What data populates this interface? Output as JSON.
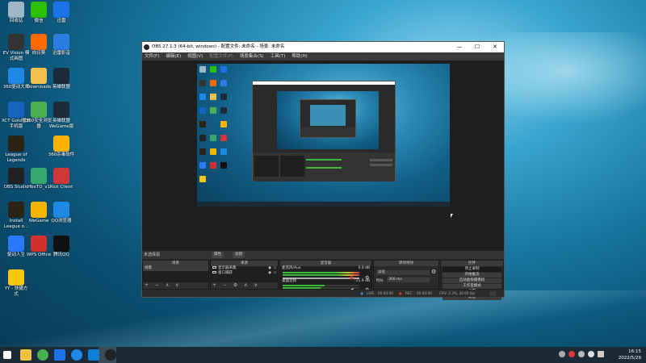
{
  "desktop": {
    "icons": [
      {
        "label": "回收站",
        "color": "#9fb8c8"
      },
      {
        "label": "微信",
        "color": "#2dc100"
      },
      {
        "label": "迅雷",
        "color": "#1a73e8"
      },
      {
        "label": "EV Vision 模\n式画图",
        "color": "#333333"
      },
      {
        "label": "向日葵",
        "color": "#ff6a00"
      },
      {
        "label": "迅雷影音",
        "color": "#2a7de1"
      },
      {
        "label": "360驱动大师",
        "color": "#1e88e5"
      },
      {
        "label": "Downloads",
        "color": "#f2c14e"
      },
      {
        "label": "英雄联盟",
        "color": "#1b2b3a"
      },
      {
        "label": "XCT Gold播放\n手机版",
        "color": "#1565c0"
      },
      {
        "label": "360安全浏览\n器",
        "color": "#4caf50"
      },
      {
        "label": "英雄联盟\nWeGame版",
        "color": "#1b2b3a"
      },
      {
        "label": "League of\nLegends",
        "color": "#2b2416"
      },
      {
        "label": "",
        "color": "#00000000"
      },
      {
        "label": "360杀毒软件",
        "color": "#ffb300"
      },
      {
        "label": "OBS Studio",
        "color": "#222222"
      },
      {
        "label": "HbxTO_v1",
        "color": "#37a86b"
      },
      {
        "label": "Riot Client",
        "color": "#d13639"
      },
      {
        "label": "Install\nLeague o...",
        "color": "#2b2416"
      },
      {
        "label": "WeGame",
        "color": "#f7b400"
      },
      {
        "label": "QQ浏览器",
        "color": "#1e88e5"
      },
      {
        "label": "驱动人生",
        "color": "#2979ff"
      },
      {
        "label": "WPS Office",
        "color": "#d32f2f"
      },
      {
        "label": "腾讯QQ",
        "color": "#111111"
      },
      {
        "label": "YY - 快捷方\n式",
        "color": "#f9c80e"
      }
    ]
  },
  "obs": {
    "title": "OBS 27.1.3 (64-bit, windows) - 配置文件: 未命名 - 场景: 未命名",
    "window_buttons": {
      "minimize": "—",
      "maximize": "☐",
      "close": "✕"
    },
    "menu": [
      "文件(F)",
      "编辑(E)",
      "视图(V)",
      "配置文件(P)",
      "场景集合(S)",
      "工具(T)",
      "帮助(H)"
    ],
    "source_bar": {
      "label": "未选择源",
      "properties": "属性",
      "filters": "滤镜"
    },
    "docks": {
      "scenes": {
        "title": "场景",
        "items": [
          "场景"
        ]
      },
      "sources": {
        "title": "来源",
        "items": [
          {
            "name": "显示器采集"
          },
          {
            "name": "窗口捕获"
          }
        ]
      },
      "mixer": {
        "title": "混音器",
        "channels": [
          {
            "name": "麦克风/Aux",
            "db": "0.0 dB"
          },
          {
            "name": "桌面音频",
            "db": "-11.9 dB"
          }
        ]
      },
      "transitions": {
        "title": "转场特效",
        "type": "淡化",
        "duration_label": "时长",
        "duration": "300 ms"
      },
      "controls": {
        "title": "控件",
        "buttons": [
          "停止录制",
          "开始推流",
          "启动虚拟摄像机",
          "工作室模式",
          "设置",
          "退出"
        ]
      }
    },
    "status": {
      "live_label": "LIVE:",
      "live_time": "00:00:00",
      "rec_label": "REC:",
      "rec_time": "00:00:00",
      "cpu": "CPU: 2.3%, 30.00 fps"
    }
  },
  "taskbar": {
    "time": "16:15",
    "date": "2022/5/29",
    "pinned": [
      {
        "name": "start",
        "color": "#ffffff"
      },
      {
        "name": "files",
        "color": "#f0c040"
      },
      {
        "name": "360",
        "color": "#4caf50"
      },
      {
        "name": "xunlei",
        "color": "#1a73e8"
      },
      {
        "name": "qq-browser",
        "color": "#1e88e5"
      },
      {
        "name": "edge",
        "color": "#0f7fd8"
      },
      {
        "name": "obs",
        "color": "#222222"
      }
    ]
  }
}
